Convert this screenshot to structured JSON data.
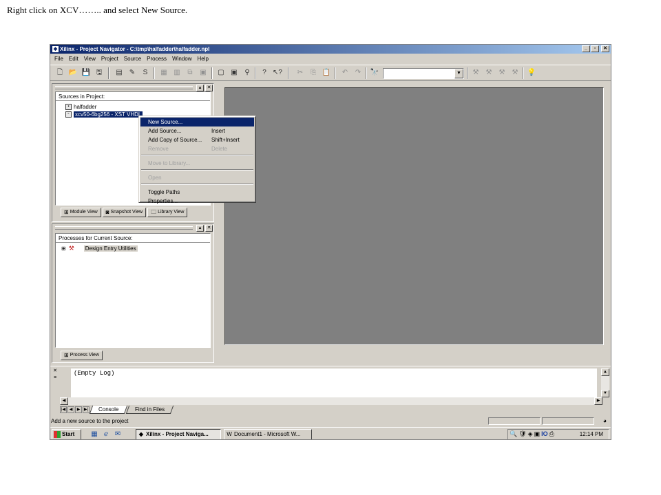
{
  "caption": "Right click on XCV…….. and select New Source.",
  "window": {
    "title": "Xilinx - Project Navigator - C:\\tmp\\halfadder\\halfadder.npl",
    "controls": [
      "_",
      "▫",
      "✕"
    ]
  },
  "menubar": [
    "File",
    "Edit",
    "View",
    "Project",
    "Source",
    "Process",
    "Window",
    "Help"
  ],
  "sources_pane": {
    "title": "Sources in Project:",
    "items": [
      {
        "label": "halfadder"
      },
      {
        "label": "xcv50-6bg256 - XST VHDL",
        "selected": true
      }
    ],
    "tabs": [
      "Module View",
      "Snapshot View",
      "Library View"
    ]
  },
  "context_menu": {
    "items": [
      {
        "label": "New Source...",
        "shortcut": "",
        "state": "active"
      },
      {
        "label": "Add Source...",
        "shortcut": "Insert",
        "state": "enabled"
      },
      {
        "label": "Add Copy of Source...",
        "shortcut": "Shift+Insert",
        "state": "enabled"
      },
      {
        "label": "Remove",
        "shortcut": "Delete",
        "state": "disabled"
      },
      {
        "label": "Move to Library...",
        "shortcut": "",
        "state": "disabled"
      },
      {
        "label": "Open",
        "shortcut": "",
        "state": "disabled"
      },
      {
        "label": "Toggle Paths",
        "shortcut": "",
        "state": "enabled"
      },
      {
        "label": "Properties...",
        "shortcut": "",
        "state": "enabled"
      }
    ]
  },
  "processes_pane": {
    "title": "Processes for Current Source:",
    "items": [
      {
        "label": "Design Entry Utilities"
      }
    ],
    "tabs": [
      "Process View"
    ]
  },
  "console": {
    "text": "(Empty Log)",
    "tabs": [
      "Console",
      "Find in Files"
    ]
  },
  "statusbar": {
    "text": "Add a new source to the project"
  },
  "taskbar": {
    "start_label": "Start",
    "tasks": [
      {
        "label": "Xilinx - Project Naviga...",
        "active": true
      },
      {
        "label": "Document1 - Microsoft W...",
        "active": false
      }
    ],
    "tray_text": "IO",
    "clock": "12:14 PM"
  },
  "colors": {
    "title_bar": "#0a246a",
    "face": "#d4d0c8",
    "workspace": "#808080",
    "selection": "#0a246a"
  }
}
